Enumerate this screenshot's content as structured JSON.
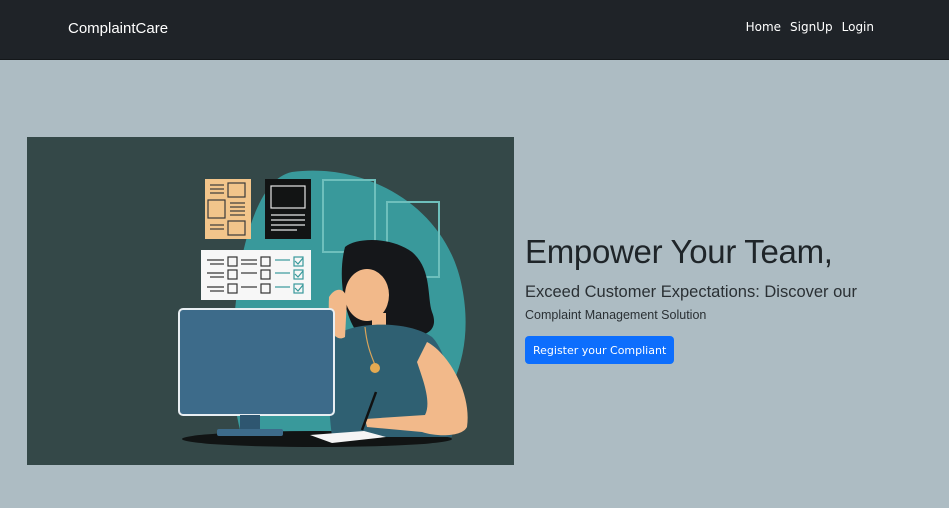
{
  "navbar": {
    "brand": "ComplaintCare",
    "links": [
      "Home",
      "SignUp",
      "Login"
    ]
  },
  "hero": {
    "heading": "Empower Your Team,",
    "subheading_line1": "Exceed Customer Expectations: Discover our",
    "subheading_line2": "Complaint Management Solution",
    "button_label": "Register your Compliant"
  },
  "colors": {
    "navbar_bg": "#1f2328",
    "page_bg": "#adbcc3",
    "illustration_bg": "#344848",
    "button_bg": "#0d6efd"
  }
}
